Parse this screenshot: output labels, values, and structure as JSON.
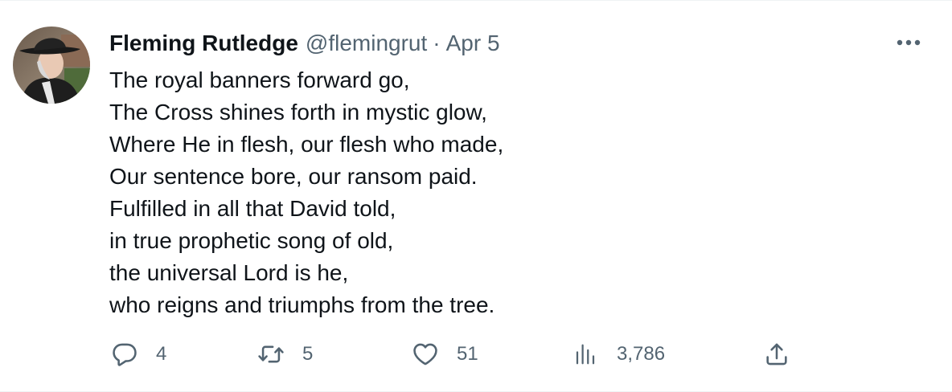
{
  "tweet": {
    "author": {
      "display_name": "Fleming Rutledge",
      "handle": "@flemingrut",
      "avatar_icon": "avatar-photo"
    },
    "separator": "·",
    "date": "Apr 5",
    "more_icon": "more-horizontal-icon",
    "lines": [
      "The royal banners forward go,",
      "The Cross shines forth in mystic glow,",
      "Where He in flesh, our flesh who made,",
      "Our sentence bore, our ransom paid.",
      "Fulfilled in all that David told,",
      "in true prophetic song of old,",
      "the universal Lord is he,",
      "who reigns and triumphs from the tree."
    ],
    "actions": {
      "reply": {
        "icon": "reply-icon",
        "count": "4"
      },
      "retweet": {
        "icon": "retweet-icon",
        "count": "5"
      },
      "like": {
        "icon": "heart-icon",
        "count": "51"
      },
      "views": {
        "icon": "views-icon",
        "count": "3,786"
      },
      "share": {
        "icon": "share-icon"
      }
    }
  },
  "colors": {
    "text_primary": "#0f1419",
    "text_secondary": "#536471",
    "border": "#eff3f4",
    "background": "#ffffff"
  }
}
